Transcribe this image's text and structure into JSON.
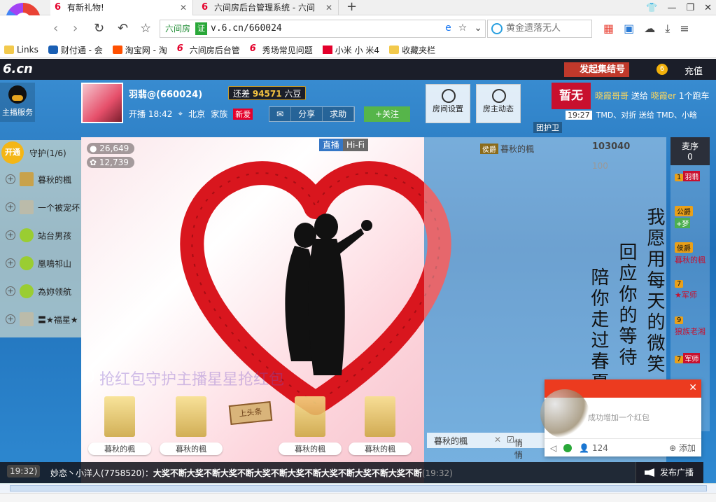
{
  "browser": {
    "tabs": [
      {
        "label": "有新礼物!",
        "active": true
      },
      {
        "label": "六间房后台管理系统 - 六间",
        "active": false
      }
    ],
    "new_tab": "+",
    "address": {
      "badge": "六间房",
      "cert": "证",
      "url": "v.6.cn/660024"
    },
    "search": {
      "placeholder": "黄金遗落无人"
    },
    "bookmarks": [
      "Links",
      "财付通 - 会",
      "淘宝网 - 淘",
      "六间房后台管",
      "秀场常见问题",
      "小米 小 米4",
      "收藏夹栏"
    ]
  },
  "site": {
    "logo": "6.cn",
    "rally_button": "发起集结号",
    "coin_count": "6",
    "recharge": "充值",
    "anchor_service": "主播服务",
    "host": {
      "name": "羽翡@(660024)",
      "gap_label": "还差",
      "gap_value": "94571",
      "gap_suffix": "六豆",
      "start_time": "开播 18:42",
      "location": "北京",
      "family_label": "家族",
      "family_badge": "新爱",
      "actions": [
        "分享",
        "求助"
      ],
      "follow": "+关注"
    },
    "room_buttons": [
      "房间设置",
      "房主动态"
    ],
    "promo": "暂无",
    "gift_feed": {
      "from": "晓霞哥哥",
      "verb": "送给",
      "to": "晓霞er",
      "tail": "1个跑车",
      "time": "19:27",
      "line2": "TMD、对折 送给 TMD、小晗"
    },
    "guard_chip": "团护卫",
    "guard": {
      "open": "开通",
      "title": "守护(1/6)",
      "members": [
        "暮秋的楓",
        "一个被宠坏",
        "站台男孩",
        "凰鳴祁山",
        "為妳领航",
        "〓★福星★"
      ]
    },
    "stats": {
      "viewers": "26,649",
      "fans": "12,739"
    },
    "live_tags": [
      "直播",
      "Hi-Fi"
    ],
    "podiums": [
      "暮秋的楓",
      "暮秋的楓",
      "暮秋的楓",
      "暮秋的楓"
    ],
    "sign_text": "上头条",
    "faded_text": "抢红包守护主播星星抢红包",
    "poem_cols": [
      "我愿用每天的微笑",
      "回应你的等待",
      "陪你走过春夏秋冬"
    ],
    "chat": {
      "user": "暮秋的楓",
      "rank": "侯爵",
      "wealth": "103040",
      "wealth_small": "100",
      "tab_name": "暮秋的楓",
      "tab_private": "悄悄"
    },
    "queue": {
      "title": "麦序",
      "count": "0",
      "items": [
        {
          "lv": "1",
          "name": "羽翡"
        },
        {
          "lv": "公爵",
          "name": "+梦"
        },
        {
          "lv": "侯爵",
          "name": "暮秋的楓"
        },
        {
          "lv": "7",
          "name": "★军师"
        },
        {
          "lv": "9",
          "name": "狼族老湘"
        },
        {
          "lv": "7",
          "name": "军师"
        }
      ]
    },
    "red_packet": {
      "text": "成功增加一个红包",
      "count": "124",
      "add": "添加"
    },
    "broadcast": {
      "left_time": "19:32)",
      "sender": "妙恋丶小洋人(7758520)",
      "message": "大奖不断大奖不断大奖不断大奖不断大奖不断大奖不断大奖不断大奖不断",
      "time": "(19:32)",
      "button": "发布广播"
    }
  }
}
